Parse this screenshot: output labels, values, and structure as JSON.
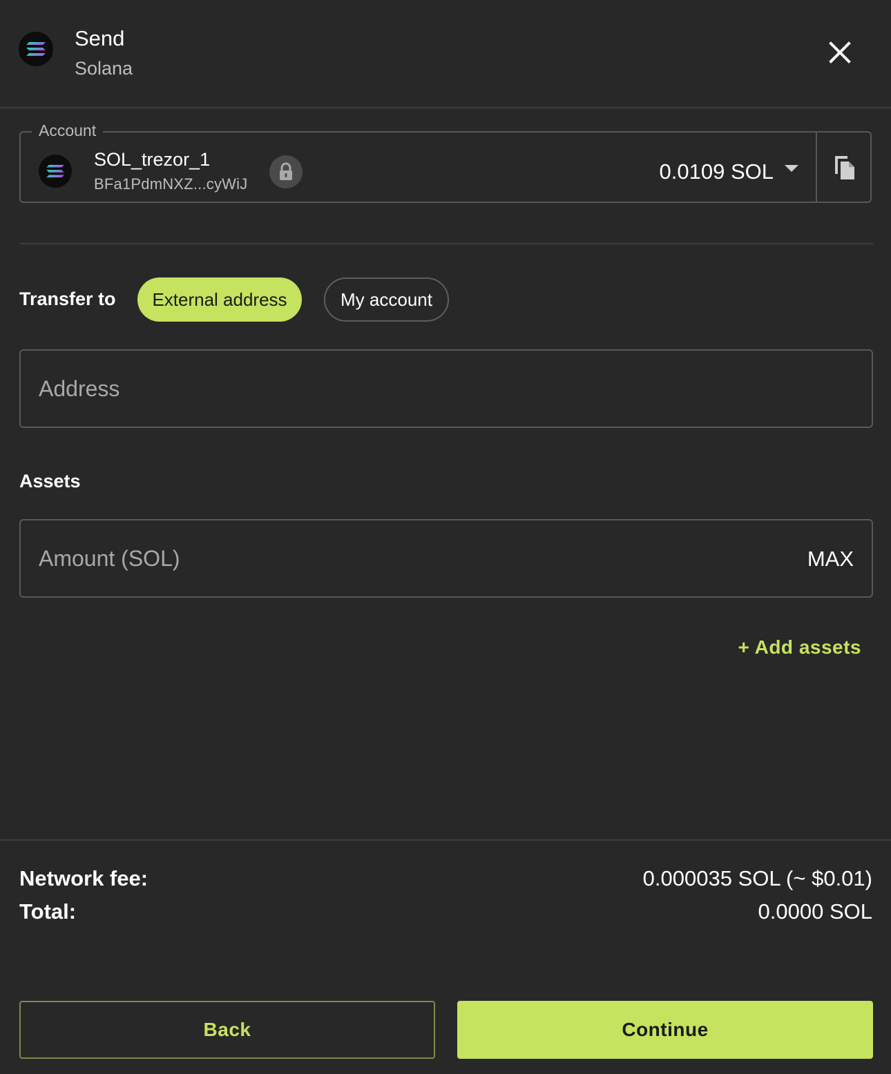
{
  "header": {
    "title": "Send",
    "subtitle": "Solana",
    "logo_icon": "solana-logo-icon",
    "close_icon": "close-icon"
  },
  "account": {
    "legend": "Account",
    "name": "SOL_trezor_1",
    "address": "BFa1PdmNXZ...cyWiJ",
    "balance": "0.0109 SOL",
    "lock_icon": "lock-icon",
    "dropdown_icon": "caret-down-icon",
    "copy_icon": "copy-icon"
  },
  "transfer": {
    "label": "Transfer to",
    "options": [
      "External address",
      "My account"
    ],
    "selected": "External address"
  },
  "address_input": {
    "placeholder": "Address",
    "value": ""
  },
  "assets": {
    "label": "Assets",
    "amount_placeholder": "Amount (SOL)",
    "amount_value": "",
    "max_label": "MAX",
    "add_assets_label": "+ Add assets"
  },
  "summary": {
    "fee_label": "Network fee:",
    "fee_value": "0.000035 SOL (~ $0.01)",
    "total_label": "Total:",
    "total_value": "0.0000 SOL"
  },
  "actions": {
    "back_label": "Back",
    "continue_label": "Continue"
  },
  "colors": {
    "background": "#282828",
    "accent": "#c5e35f",
    "border": "#585858",
    "muted_text": "#bdbdbd"
  }
}
